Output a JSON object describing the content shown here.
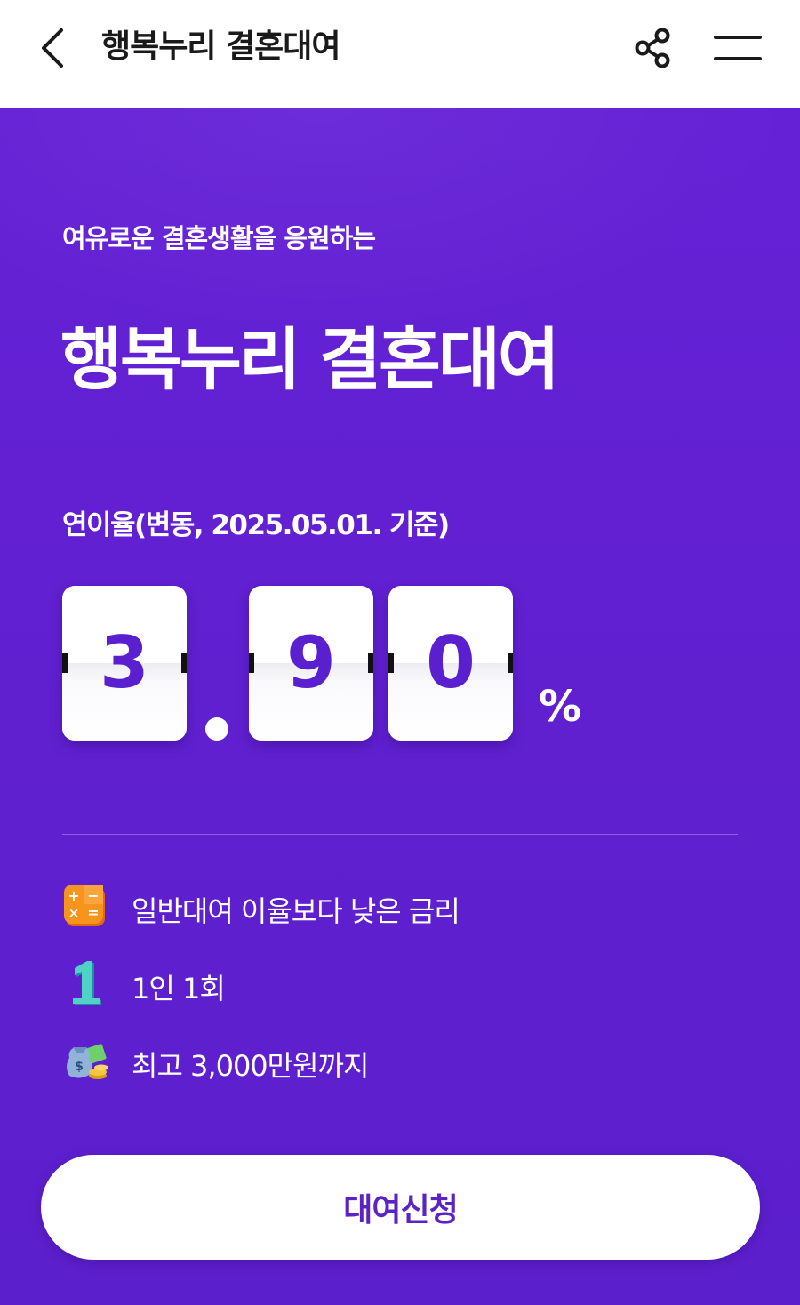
{
  "header": {
    "title": "행복누리 결혼대여",
    "back_icon": "chevron-left-icon",
    "share_icon": "share-icon",
    "menu_icon": "hamburger-menu-icon"
  },
  "hero": {
    "subtitle": "여유로운 결혼생활을 응원하는",
    "title": "행복누리 결혼대여",
    "rate_label": "연이율(변동, 2025.05.01. 기준)",
    "rate": {
      "digits": [
        "3",
        "9",
        "0"
      ],
      "dot": ".",
      "unit": "%"
    }
  },
  "features": [
    {
      "icon": "calculator-icon",
      "text": "일반대여 이율보다 낮은 금리"
    },
    {
      "icon": "number-one-icon",
      "text": "1인 1회"
    },
    {
      "icon": "money-bag-icon",
      "text": "최고 3,000만원까지"
    }
  ],
  "cta": {
    "label": "대여신청"
  },
  "colors": {
    "background": "#5f20d1",
    "digit": "#5a1fcf",
    "button_text": "#5b22c6",
    "white": "#ffffff"
  }
}
